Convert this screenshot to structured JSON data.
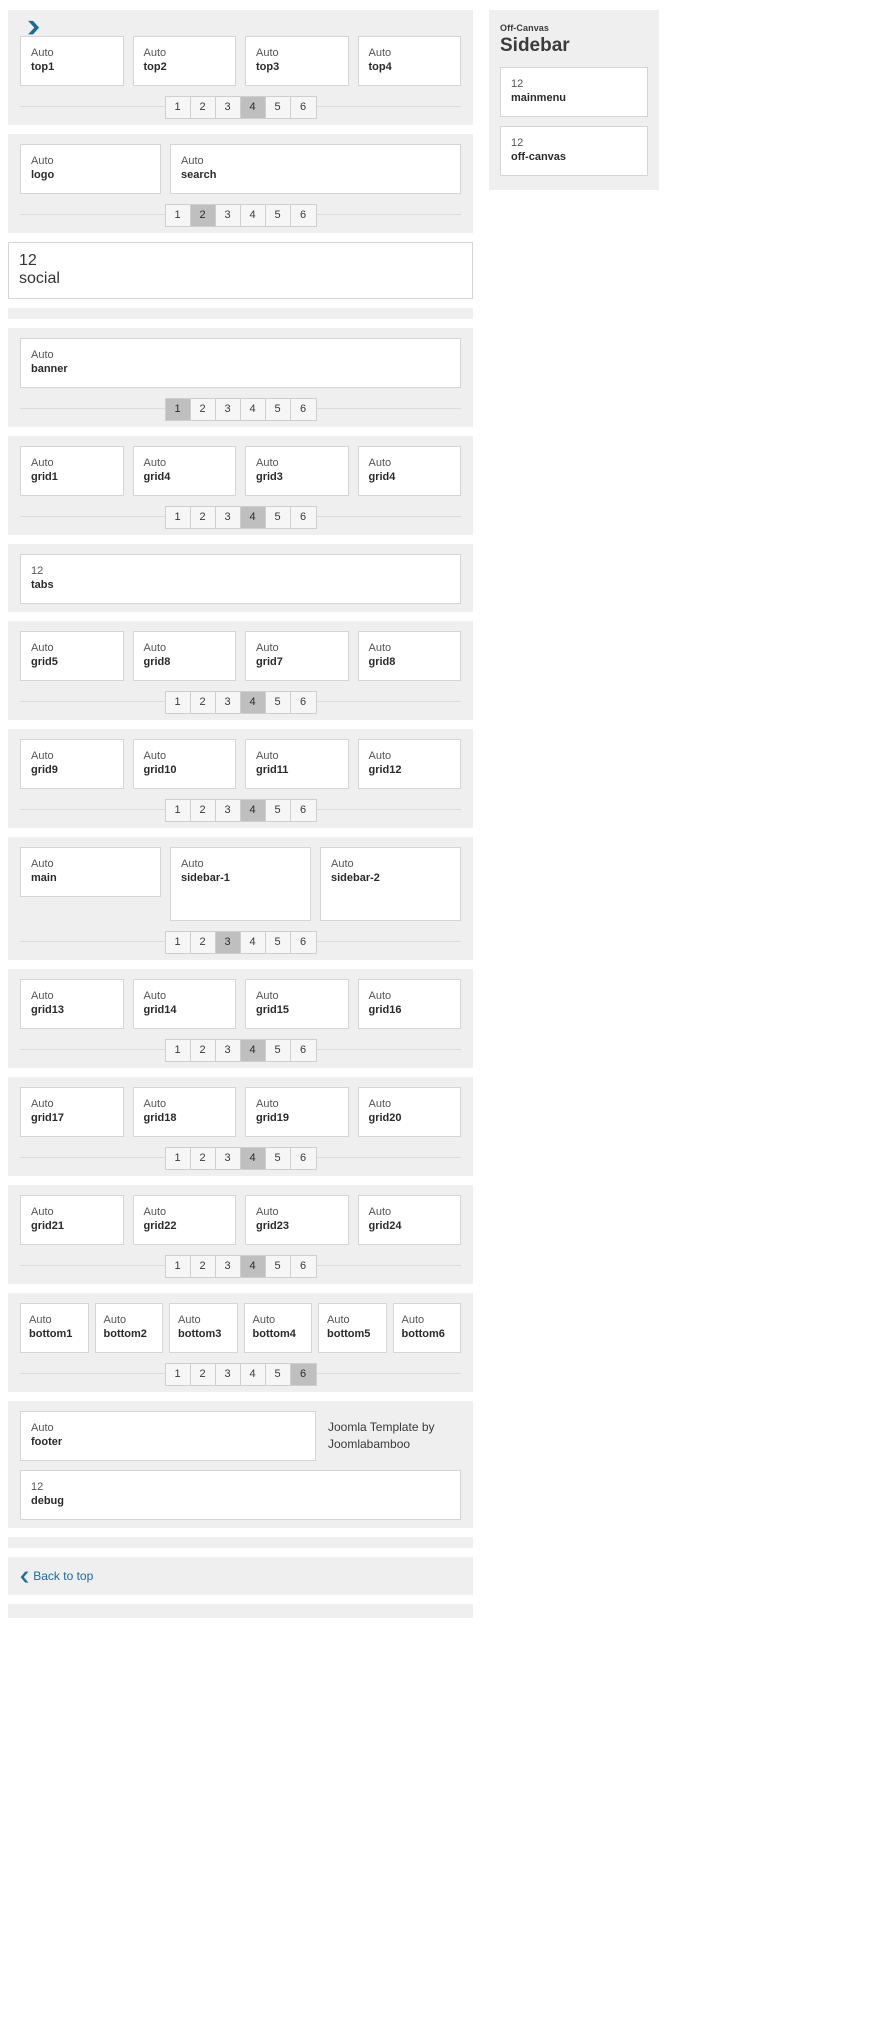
{
  "sections": [
    {
      "id": "top",
      "has_caret": true,
      "boxes": [
        {
          "size": "Auto",
          "name": "top1"
        },
        {
          "size": "Auto",
          "name": "top2"
        },
        {
          "size": "Auto",
          "name": "top3"
        },
        {
          "size": "Auto",
          "name": "top4"
        }
      ],
      "picker": {
        "options": [
          "1",
          "2",
          "3",
          "4",
          "5",
          "6"
        ],
        "active": "4"
      }
    },
    {
      "id": "header",
      "has_caret": false,
      "boxes": [
        {
          "size": "Auto",
          "name": "logo"
        },
        {
          "size": "Auto",
          "name": "search"
        }
      ],
      "picker": {
        "options": [
          "1",
          "2",
          "3",
          "4",
          "5",
          "6"
        ],
        "active": "2"
      }
    },
    {
      "id": "social",
      "single": {
        "size": "12",
        "name": "social"
      }
    },
    {
      "id": "banner",
      "boxes": [
        {
          "size": "Auto",
          "name": "banner"
        }
      ],
      "picker": {
        "options": [
          "1",
          "2",
          "3",
          "4",
          "5",
          "6"
        ],
        "active": "1"
      }
    },
    {
      "id": "grid-a",
      "boxes": [
        {
          "size": "Auto",
          "name": "grid1"
        },
        {
          "size": "Auto",
          "name": "grid4"
        },
        {
          "size": "Auto",
          "name": "grid3"
        },
        {
          "size": "Auto",
          "name": "grid4"
        }
      ],
      "picker": {
        "options": [
          "1",
          "2",
          "3",
          "4",
          "5",
          "6"
        ],
        "active": "4"
      }
    },
    {
      "id": "tabs",
      "single": {
        "size": "12",
        "name": "tabs"
      }
    },
    {
      "id": "grid-b",
      "boxes": [
        {
          "size": "Auto",
          "name": "grid5"
        },
        {
          "size": "Auto",
          "name": "grid8"
        },
        {
          "size": "Auto",
          "name": "grid7"
        },
        {
          "size": "Auto",
          "name": "grid8"
        }
      ],
      "picker": {
        "options": [
          "1",
          "2",
          "3",
          "4",
          "5",
          "6"
        ],
        "active": "4"
      }
    },
    {
      "id": "grid-c",
      "boxes": [
        {
          "size": "Auto",
          "name": "grid9"
        },
        {
          "size": "Auto",
          "name": "grid10"
        },
        {
          "size": "Auto",
          "name": "grid11"
        },
        {
          "size": "Auto",
          "name": "grid12"
        }
      ],
      "picker": {
        "options": [
          "1",
          "2",
          "3",
          "4",
          "5",
          "6"
        ],
        "active": "4"
      }
    },
    {
      "id": "content",
      "boxes": [
        {
          "size": "Auto",
          "name": "main",
          "height": "short"
        },
        {
          "size": "Auto",
          "name": "sidebar-1",
          "height": "tall"
        },
        {
          "size": "Auto",
          "name": "sidebar-2",
          "height": "tall"
        }
      ],
      "picker": {
        "options": [
          "1",
          "2",
          "3",
          "4",
          "5",
          "6"
        ],
        "active": "3"
      }
    },
    {
      "id": "grid-d",
      "boxes": [
        {
          "size": "Auto",
          "name": "grid13"
        },
        {
          "size": "Auto",
          "name": "grid14"
        },
        {
          "size": "Auto",
          "name": "grid15"
        },
        {
          "size": "Auto",
          "name": "grid16"
        }
      ],
      "picker": {
        "options": [
          "1",
          "2",
          "3",
          "4",
          "5",
          "6"
        ],
        "active": "4"
      }
    },
    {
      "id": "grid-e",
      "boxes": [
        {
          "size": "Auto",
          "name": "grid17"
        },
        {
          "size": "Auto",
          "name": "grid18"
        },
        {
          "size": "Auto",
          "name": "grid19"
        },
        {
          "size": "Auto",
          "name": "grid20"
        }
      ],
      "picker": {
        "options": [
          "1",
          "2",
          "3",
          "4",
          "5",
          "6"
        ],
        "active": "4"
      }
    },
    {
      "id": "grid-f",
      "boxes": [
        {
          "size": "Auto",
          "name": "grid21"
        },
        {
          "size": "Auto",
          "name": "grid22"
        },
        {
          "size": "Auto",
          "name": "grid23"
        },
        {
          "size": "Auto",
          "name": "grid24"
        }
      ],
      "picker": {
        "options": [
          "1",
          "2",
          "3",
          "4",
          "5",
          "6"
        ],
        "active": "4"
      }
    },
    {
      "id": "bottom",
      "boxes": [
        {
          "size": "Auto",
          "name": "bottom1"
        },
        {
          "size": "Auto",
          "name": "bottom2"
        },
        {
          "size": "Auto",
          "name": "bottom3"
        },
        {
          "size": "Auto",
          "name": "bottom4"
        },
        {
          "size": "Auto",
          "name": "bottom5"
        },
        {
          "size": "Auto",
          "name": "bottom6"
        }
      ],
      "picker": {
        "options": [
          "1",
          "2",
          "3",
          "4",
          "5",
          "6"
        ],
        "active": "6"
      }
    }
  ],
  "footer": {
    "box": {
      "size": "Auto",
      "name": "footer"
    },
    "credit_line_1": "Joomla Template by",
    "credit_line_2": "Joomlabamboo",
    "debug": {
      "size": "12",
      "name": "debug"
    }
  },
  "back_to_top": {
    "label": "Back to top",
    "icon": "chevron-up-icon"
  },
  "offcanvas": {
    "eyebrow": "Off-Canvas",
    "title": "Sidebar",
    "boxes": [
      {
        "size": "12",
        "name": "mainmenu"
      },
      {
        "size": "12",
        "name": "off-canvas"
      }
    ]
  },
  "colors": {
    "band": "#efefef",
    "box_border": "#d5d5d5",
    "active_cell": "#bfbfbf",
    "link": "#1a6c9c"
  },
  "icons": {
    "caret_down": "chevron-down-icon"
  }
}
